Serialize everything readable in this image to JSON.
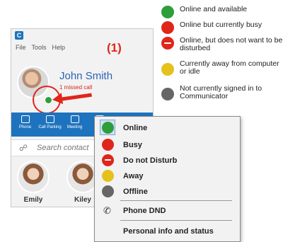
{
  "colors": {
    "online": "#2e9e3a",
    "busy": "#e0251b",
    "dnd": "#e0251b",
    "away": "#e4c21b",
    "offline": "#666666",
    "brand_blue": "#1e73be",
    "annotation": "#e0251b"
  },
  "legend": [
    {
      "text": "Online and available",
      "color": "#2e9e3a",
      "icon": "online-dot"
    },
    {
      "text": "Online but currently busy",
      "color": "#e0251b",
      "icon": "busy-dot"
    },
    {
      "text": "Online, but does not want to be disturbed",
      "color": "#e0251b",
      "icon": "dnd-dot"
    },
    {
      "text": "Currently away from computer or idle",
      "color": "#e4c21b",
      "icon": "away-dot"
    },
    {
      "text": "Not currently signed in to Communicator",
      "color": "#666666",
      "icon": "offline-dot"
    }
  ],
  "window": {
    "app_icon_letter": "C",
    "menu": [
      "File",
      "Tools",
      "Help"
    ],
    "callout": "(1)",
    "user": {
      "name": "John Smith",
      "missed": "1 missed call"
    },
    "toolbar": [
      {
        "label": "Phone",
        "icon": "phone-icon"
      },
      {
        "label": "Call Parking",
        "icon": "parking-icon"
      },
      {
        "label": "Meeting",
        "icon": "meeting-icon"
      },
      {
        "label": "V",
        "icon": "video-icon"
      }
    ],
    "search": {
      "placeholder": "Search contact"
    },
    "contacts": [
      {
        "name": "Emily"
      },
      {
        "name": "Kiley"
      }
    ]
  },
  "status_menu": {
    "items": [
      {
        "label": "Online",
        "icon": "online-dot",
        "color": "#2e9e3a",
        "selected": true
      },
      {
        "label": "Busy",
        "icon": "busy-dot",
        "color": "#e0251b"
      },
      {
        "label": "Do not Disturb",
        "icon": "dnd-dot",
        "color": "#e0251b"
      },
      {
        "label": "Away",
        "icon": "away-dot",
        "color": "#e4c21b"
      },
      {
        "label": "Offline",
        "icon": "offline-dot",
        "color": "#666666"
      }
    ],
    "phone_dnd": "Phone DND",
    "personal_info": "Personal info and status"
  }
}
